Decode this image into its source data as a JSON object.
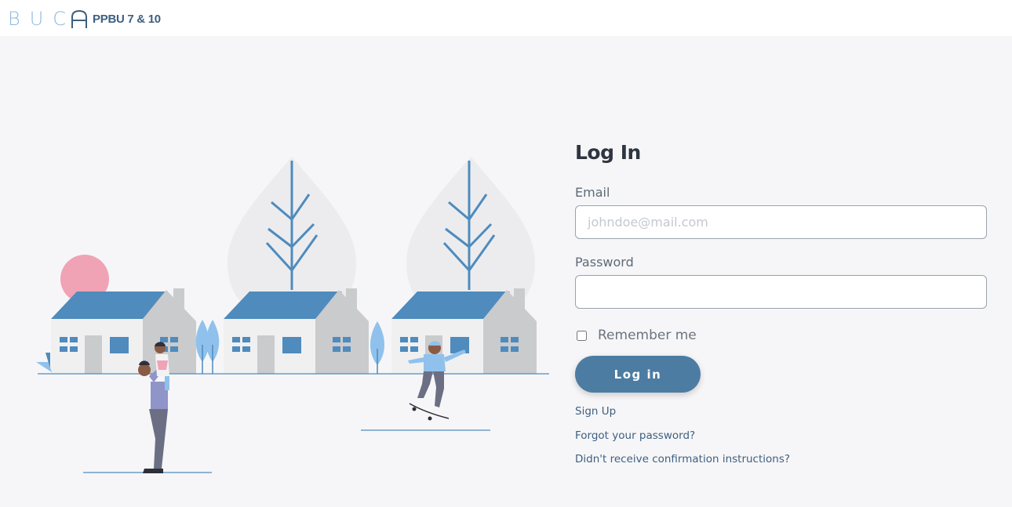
{
  "header": {
    "brand_logo": "BUC",
    "brand_subtitle": "PPBU 7 & 10"
  },
  "login": {
    "title": "Log In",
    "email_label": "Email",
    "email_placeholder": "johndoe@mail.com",
    "email_value": "",
    "password_label": "Password",
    "password_value": "",
    "remember_label": "Remember me",
    "remember_checked": false,
    "submit_label": "Log in",
    "links": {
      "sign_up": "Sign Up",
      "forgot_password": "Forgot your password?",
      "confirmation": "Didn't receive confirmation instructions?"
    }
  },
  "colors": {
    "accent": "#4d7ca2",
    "brand_light": "#8fb8df",
    "roof": "#4f8bbd",
    "sun": "#f0a3b5",
    "tree_light": "#90c1ec"
  }
}
